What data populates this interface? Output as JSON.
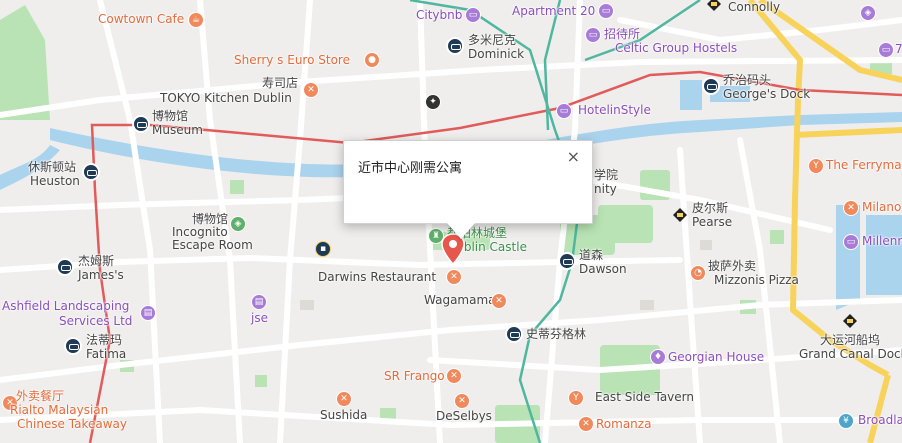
{
  "popup": {
    "title": "近市中心刚需公寓",
    "close_glyph": "×"
  },
  "metro_stations": [
    {
      "id": "dominick",
      "zh": "多米尼克",
      "en": "Dominick"
    },
    {
      "id": "museum",
      "zh": "博物馆",
      "en": "Museum"
    },
    {
      "id": "heuston",
      "zh": "休斯顿站",
      "en": "Heuston"
    },
    {
      "id": "james",
      "zh": "杰姆斯",
      "en": "James's"
    },
    {
      "id": "fatima",
      "zh": "法蒂玛",
      "en": "Fatima"
    },
    {
      "id": "georges-dock",
      "zh": "乔治码头",
      "en": "George's Dock"
    },
    {
      "id": "dawson",
      "zh": "道森",
      "en": "Dawson"
    },
    {
      "id": "stephens-green",
      "zh": "史蒂芬格林",
      "en": ""
    }
  ],
  "rail_stations": [
    {
      "id": "connolly",
      "zh": "",
      "en": "Connolly"
    },
    {
      "id": "pearse",
      "zh": "皮尔斯",
      "en": "Pearse"
    },
    {
      "id": "grand-canal-dock",
      "zh": "大运河船坞",
      "en": "Grand Canal Dock"
    }
  ],
  "places": {
    "cowtown_cafe": "Cowtown Cafe",
    "citybnb": "Citybnb",
    "apartment20": "Apartment 20",
    "sherrys": "Sherry s Euro Store",
    "sushi_zh": "寿司店",
    "tokyo_kitchen": "TOKYO Kitchen Dublin",
    "hostel_zh": "招待所",
    "celtic": "Celtic Group Hostels",
    "hotelinstyle": "HotelinStyle",
    "trinity_zh": "学院",
    "trinity_en": "nity",
    "museum_zh": "博物馆",
    "incognito1": "Incognito",
    "incognito2": "Escape Room",
    "castle_zh": "都柏林城堡",
    "castle_en": "Dublin Castle",
    "darwins": "Darwins Restaurant",
    "wagamama": "Wagamama",
    "ferryman": "The Ferryman",
    "milano": "Milano",
    "millennium": "Millenn",
    "pizza_zh": "披萨外卖",
    "mizzonis": "Mizzonis Pizza",
    "ashfield1": "Ashfield Landscaping",
    "ashfield2": "Services Ltd",
    "jse": "jse",
    "georgian": "Georgian House",
    "srfrango": "SR Frango",
    "takeaway_zh": "外卖餐厅",
    "rialto1": "Rialto Malaysian",
    "rialto2": "Chinese Takeaway",
    "sushida": "Sushida",
    "deselbys": "DeSelbys",
    "eastside": "East Side Tavern",
    "romanza": "Romanza",
    "broadlands": "Broadla",
    "number7": "7"
  },
  "colors": {
    "road_major": "#f7d35c",
    "tram_red": "#e15b5b",
    "tram_green": "#4fb7a0",
    "water": "#aad3ee",
    "park": "#b9e3b4",
    "marker": "#e8574b"
  }
}
